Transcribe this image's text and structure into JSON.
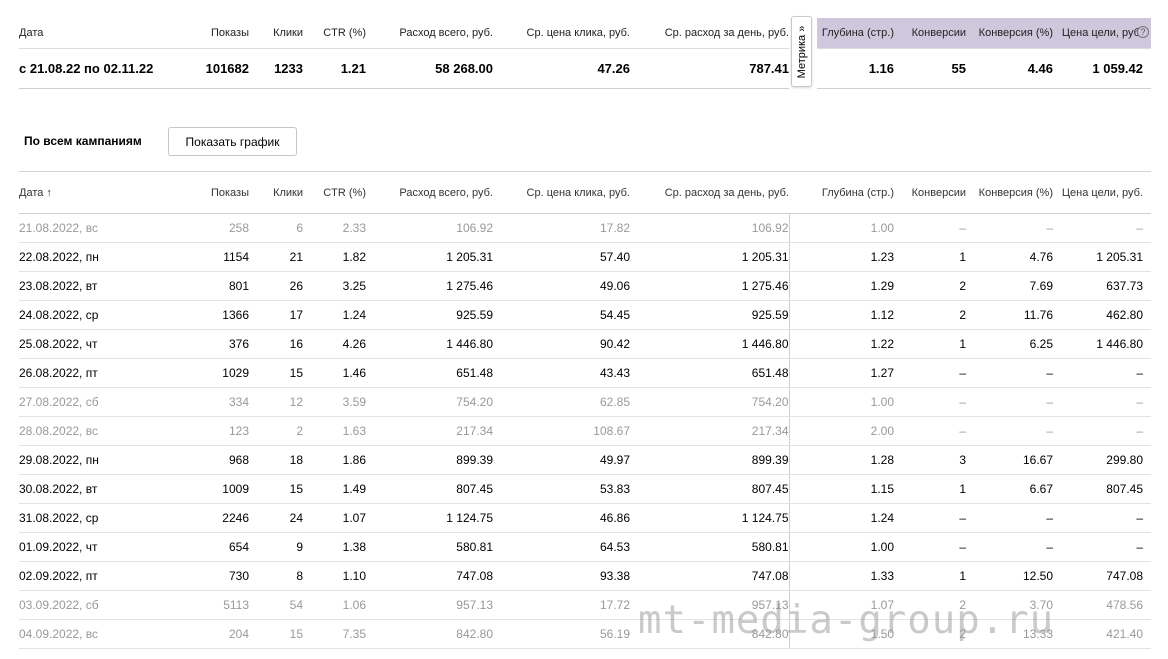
{
  "summary": {
    "headers": [
      "Дата",
      "Показы",
      "Клики",
      "CTR (%)",
      "Расход всего, руб.",
      "Ср. цена клика, руб.",
      "Ср. расход за день, руб.",
      "Глубина (стр.)",
      "Конверсии",
      "Конверсия (%)",
      "Цена цели, руб."
    ],
    "row": [
      "с 21.08.22 по 02.11.22",
      "101682",
      "1233",
      "1.21",
      "58 268.00",
      "47.26",
      "787.41",
      "1.16",
      "55",
      "4.46",
      "1 059.42"
    ],
    "metrika_label": "Метрика »",
    "info_icon": "?",
    "header_accent": "#cfc7dc"
  },
  "section": {
    "title": "По всем кампаниям",
    "show_chart_label": "Показать график"
  },
  "table": {
    "headers": [
      "Дата ↑",
      "Показы",
      "Клики",
      "CTR (%)",
      "Расход всего, руб.",
      "Ср. цена клика, руб.",
      "Ср. расход за день, руб.",
      "Глубина (стр.)",
      "Конверсии",
      "Конверсия (%)",
      "Цена цели, руб."
    ],
    "rows": [
      {
        "weekend": true,
        "cells": [
          "21.08.2022, вс",
          "258",
          "6",
          "2.33",
          "106.92",
          "17.82",
          "106.92",
          "1.00",
          "–",
          "–",
          "–"
        ]
      },
      {
        "weekend": false,
        "cells": [
          "22.08.2022, пн",
          "1154",
          "21",
          "1.82",
          "1 205.31",
          "57.40",
          "1 205.31",
          "1.23",
          "1",
          "4.76",
          "1 205.31"
        ]
      },
      {
        "weekend": false,
        "cells": [
          "23.08.2022, вт",
          "801",
          "26",
          "3.25",
          "1 275.46",
          "49.06",
          "1 275.46",
          "1.29",
          "2",
          "7.69",
          "637.73"
        ]
      },
      {
        "weekend": false,
        "cells": [
          "24.08.2022, ср",
          "1366",
          "17",
          "1.24",
          "925.59",
          "54.45",
          "925.59",
          "1.12",
          "2",
          "11.76",
          "462.80"
        ]
      },
      {
        "weekend": false,
        "cells": [
          "25.08.2022, чт",
          "376",
          "16",
          "4.26",
          "1 446.80",
          "90.42",
          "1 446.80",
          "1.22",
          "1",
          "6.25",
          "1 446.80"
        ]
      },
      {
        "weekend": false,
        "cells": [
          "26.08.2022, пт",
          "1029",
          "15",
          "1.46",
          "651.48",
          "43.43",
          "651.48",
          "1.27",
          "–",
          "–",
          "–"
        ]
      },
      {
        "weekend": true,
        "cells": [
          "27.08.2022, сб",
          "334",
          "12",
          "3.59",
          "754.20",
          "62.85",
          "754.20",
          "1.00",
          "–",
          "–",
          "–"
        ]
      },
      {
        "weekend": true,
        "cells": [
          "28.08.2022, вс",
          "123",
          "2",
          "1.63",
          "217.34",
          "108.67",
          "217.34",
          "2.00",
          "–",
          "–",
          "–"
        ]
      },
      {
        "weekend": false,
        "cells": [
          "29.08.2022, пн",
          "968",
          "18",
          "1.86",
          "899.39",
          "49.97",
          "899.39",
          "1.28",
          "3",
          "16.67",
          "299.80"
        ]
      },
      {
        "weekend": false,
        "cells": [
          "30.08.2022, вт",
          "1009",
          "15",
          "1.49",
          "807.45",
          "53.83",
          "807.45",
          "1.15",
          "1",
          "6.67",
          "807.45"
        ]
      },
      {
        "weekend": false,
        "cells": [
          "31.08.2022, ср",
          "2246",
          "24",
          "1.07",
          "1 124.75",
          "46.86",
          "1 124.75",
          "1.24",
          "–",
          "–",
          "–"
        ]
      },
      {
        "weekend": false,
        "cells": [
          "01.09.2022, чт",
          "654",
          "9",
          "1.38",
          "580.81",
          "64.53",
          "580.81",
          "1.00",
          "–",
          "–",
          "–"
        ]
      },
      {
        "weekend": false,
        "cells": [
          "02.09.2022, пт",
          "730",
          "8",
          "1.10",
          "747.08",
          "93.38",
          "747.08",
          "1.33",
          "1",
          "12.50",
          "747.08"
        ]
      },
      {
        "weekend": true,
        "cells": [
          "03.09.2022, сб",
          "5113",
          "54",
          "1.06",
          "957.13",
          "17.72",
          "957.13",
          "1.07",
          "2",
          "3.70",
          "478.56"
        ]
      },
      {
        "weekend": true,
        "cells": [
          "04.09.2022, вс",
          "204",
          "15",
          "7.35",
          "842.80",
          "56.19",
          "842.80",
          "1.50",
          "2",
          "13.33",
          "421.40"
        ]
      }
    ]
  },
  "watermark": "mt-media-group.ru"
}
